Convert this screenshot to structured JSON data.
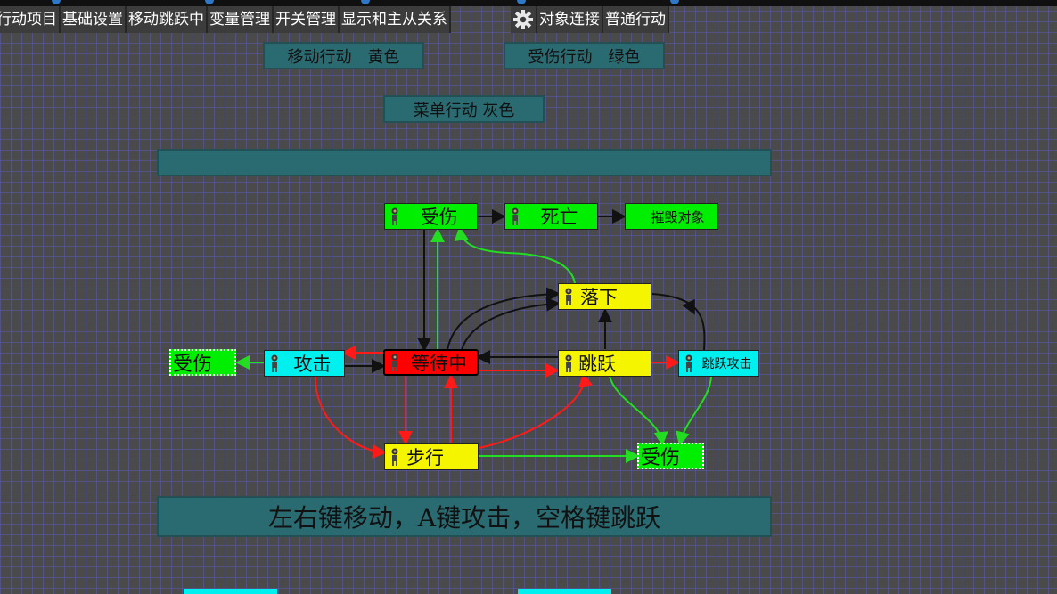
{
  "toolbar": {
    "left_tabs": [
      {
        "label": "行动项目"
      },
      {
        "label": "基础设置"
      },
      {
        "label": "移动跳跃中"
      },
      {
        "label": "变量管理"
      },
      {
        "label": "开关管理"
      },
      {
        "label": "显示和主从关系"
      }
    ],
    "gear_icon": "gear-icon",
    "right_tabs": [
      {
        "label": "对象连接"
      },
      {
        "label": "普通行动"
      }
    ]
  },
  "panels": {
    "move_action": "移动行动　黄色",
    "damage_action": "受伤行动　绿色",
    "menu_action": "菜单行动 灰色",
    "empty_bar": "",
    "instructions": "左右键移动，A键攻击，空格键跳跃"
  },
  "nodes": {
    "damage_top": "受伤",
    "death": "死亡",
    "destroy": "摧毁对象",
    "fall": "落下",
    "damage_left": "受伤",
    "attack": "攻击",
    "waiting": "等待中",
    "jump": "跳跃",
    "jump_attack": "跳跃攻击",
    "walk": "步行",
    "damage_bottom": "受伤"
  },
  "colors": {
    "damage": "#00ef00",
    "move": "#f5f500",
    "attack": "#00f0f0",
    "current": "#ff0000",
    "panel": "#2a6b72",
    "edge_black": "#111111",
    "edge_red": "#ff1a1a",
    "edge_green": "#22dd22"
  }
}
